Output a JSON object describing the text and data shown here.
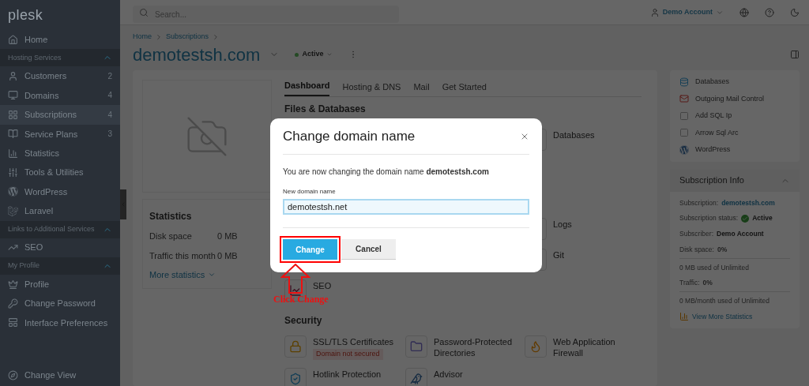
{
  "sidebar": {
    "logo": "plesk",
    "items": [
      {
        "kind": "item",
        "label": "Home",
        "selected": false
      },
      {
        "kind": "section",
        "label": "Hosting Services",
        "expanded": true
      },
      {
        "kind": "item",
        "label": "Customers",
        "count": "2",
        "selected": false
      },
      {
        "kind": "item",
        "label": "Domains",
        "count": "4",
        "selected": false
      },
      {
        "kind": "item",
        "label": "Subscriptions",
        "count": "4",
        "selected": true
      },
      {
        "kind": "item",
        "label": "Service Plans",
        "count": "3",
        "selected": false
      },
      {
        "kind": "item",
        "label": "Statistics",
        "selected": false
      },
      {
        "kind": "item",
        "label": "Tools & Utilities",
        "selected": false
      },
      {
        "kind": "item",
        "label": "WordPress",
        "selected": false
      },
      {
        "kind": "item",
        "label": "Laravel",
        "selected": false
      },
      {
        "kind": "section",
        "label": "Links to Additional Services",
        "expanded": true
      },
      {
        "kind": "item",
        "label": "SEO",
        "selected": false
      },
      {
        "kind": "section",
        "label": "My Profile",
        "expanded": true
      },
      {
        "kind": "item",
        "label": "Profile",
        "selected": false
      },
      {
        "kind": "item",
        "label": "Change Password",
        "selected": false
      },
      {
        "kind": "item",
        "label": "Interface Preferences",
        "selected": false
      }
    ],
    "footer": "Change View"
  },
  "header": {
    "search": {
      "placeholder": "Search..."
    },
    "account": "Demo Account"
  },
  "breadcrumb": [
    "Home",
    "Subscriptions"
  ],
  "page": {
    "title": "demotestsh.com",
    "status": "Active"
  },
  "statistics": {
    "title": "Statistics",
    "rows": [
      {
        "label": "Disk space",
        "value": "0 MB"
      },
      {
        "label": "Traffic this month",
        "value": "0 MB"
      }
    ],
    "more": "More statistics"
  },
  "tabs": [
    {
      "label": "Dashboard",
      "selected": true
    },
    {
      "label": "Hosting & DNS",
      "selected": false
    },
    {
      "label": "Mail",
      "selected": false
    },
    {
      "label": "Get Started",
      "selected": false
    }
  ],
  "files_section": {
    "title": "Files & Databases",
    "rows": [
      [
        null,
        null,
        {
          "label": "Databases"
        }
      ],
      [
        null,
        null,
        {
          "label": "Logs"
        }
      ],
      [
        null,
        null,
        {
          "label": "Git"
        }
      ],
      [
        {
          "label": "SEO"
        },
        null,
        null
      ]
    ]
  },
  "security_section": {
    "title": "Security",
    "rows": [
      [
        {
          "label": "SSL/TLS Certificates",
          "badge": "Domain not secured"
        },
        {
          "label": "Password-Protected Directories"
        },
        {
          "label": "Web Application Firewall"
        }
      ],
      [
        {
          "label": "Hotlink Protection"
        },
        {
          "label": "Advisor"
        },
        null
      ]
    ]
  },
  "quick_links": [
    "Databases",
    "Outgoing Mail Control",
    "Add SQL Ip",
    "Arrow Sql Arc",
    "WordPress"
  ],
  "subscription_info": {
    "title": "Subscription Info",
    "expanded": true,
    "rows": [
      {
        "kind": "link",
        "label": "Subscription:",
        "value": "demotestsh.com"
      },
      {
        "kind": "status",
        "label": "Subscription status:",
        "value": "Active"
      },
      {
        "kind": "text",
        "label": "Subscriber:",
        "value": "Demo Account"
      }
    ],
    "usage": [
      {
        "label": "Disk space:",
        "value": "0%",
        "detail": "0 MB used of Unlimited"
      },
      {
        "label": "Traffic:",
        "value": "0%",
        "detail": "0 MB/month used of Unlimited"
      }
    ],
    "link": "View More Statistics"
  },
  "dialog": {
    "title": "Change domain name",
    "message": "You are now changing the domain name **demotestsh.com**",
    "field": {
      "label": "New domain name",
      "value": "demotestsh.net"
    },
    "buttons": [
      {
        "kind": "primary",
        "label": "Change"
      },
      {
        "kind": "secondary",
        "label": "Cancel"
      }
    ]
  },
  "annotation": {
    "text": "Click Change"
  }
}
